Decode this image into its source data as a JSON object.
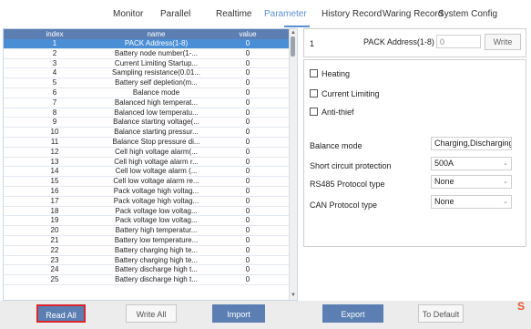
{
  "tabs": [
    {
      "label": "Monitor",
      "active": false
    },
    {
      "label": "Parallel",
      "active": false
    },
    {
      "label": "Realtime",
      "active": false
    },
    {
      "label": "Parameter",
      "active": true
    },
    {
      "label": "History Record",
      "active": false
    },
    {
      "label": "Waring Record",
      "active": false
    },
    {
      "label": "System Config",
      "active": false
    }
  ],
  "table": {
    "headers": [
      "index",
      "name",
      "value"
    ],
    "rows": [
      {
        "index": "1",
        "name": "PACK Address(1-8)",
        "value": "0"
      },
      {
        "index": "2",
        "name": "Battery node number(1-...",
        "value": "0"
      },
      {
        "index": "3",
        "name": "Current Limiting Startup...",
        "value": "0"
      },
      {
        "index": "4",
        "name": "Sampling resistance(0.01...",
        "value": "0"
      },
      {
        "index": "5",
        "name": "Battery self depletion(m...",
        "value": "0"
      },
      {
        "index": "6",
        "name": "Balance mode",
        "value": "0"
      },
      {
        "index": "7",
        "name": "Balanced high temperat...",
        "value": "0"
      },
      {
        "index": "8",
        "name": "Balanced low temperatu...",
        "value": "0"
      },
      {
        "index": "9",
        "name": "Balance starting voltage(...",
        "value": "0"
      },
      {
        "index": "10",
        "name": "Balance starting pressur...",
        "value": "0"
      },
      {
        "index": "11",
        "name": "Balance Stop pressure di...",
        "value": "0"
      },
      {
        "index": "12",
        "name": "Cell high voltage alarm(...",
        "value": "0"
      },
      {
        "index": "13",
        "name": "Cell high voltage alarm r...",
        "value": "0"
      },
      {
        "index": "14",
        "name": "Cell low voltage alarm (...",
        "value": "0"
      },
      {
        "index": "15",
        "name": "Cell low voltage alarm re...",
        "value": "0"
      },
      {
        "index": "16",
        "name": "Pack voltage high voltag...",
        "value": "0"
      },
      {
        "index": "17",
        "name": "Pack voltage high voltag...",
        "value": "0"
      },
      {
        "index": "18",
        "name": "Pack voltage low voltag...",
        "value": "0"
      },
      {
        "index": "19",
        "name": "Pack voltage low voltag...",
        "value": "0"
      },
      {
        "index": "20",
        "name": "Battery high temperatur...",
        "value": "0"
      },
      {
        "index": "21",
        "name": "Battery low temperature...",
        "value": "0"
      },
      {
        "index": "22",
        "name": "Battery charging high te...",
        "value": "0"
      },
      {
        "index": "23",
        "name": "Battery charging high te...",
        "value": "0"
      },
      {
        "index": "24",
        "name": "Battery discharge high t...",
        "value": "0"
      },
      {
        "index": "25",
        "name": "Battery discharge high t...",
        "value": "0"
      }
    ],
    "selected_row_index": 0
  },
  "pack_address": {
    "index_value": "1",
    "label": "PACK Address(1-8)",
    "input_value": "0",
    "write_label": "Write"
  },
  "checkboxes": [
    {
      "label": "Heating",
      "checked": false
    },
    {
      "label": "Current Limiting",
      "checked": false
    },
    {
      "label": "Anti-thief",
      "checked": false
    }
  ],
  "settings": [
    {
      "label": "Balance mode",
      "value": "Charging,Discharging"
    },
    {
      "label": "Short circuit protection",
      "value": "500A"
    },
    {
      "label": "RS485 Protocol type",
      "value": "None"
    },
    {
      "label": "CAN Protocol type",
      "value": "None"
    }
  ],
  "buttons": {
    "read_all": "Read All",
    "write_all": "Write All",
    "import": "Import",
    "export": "Export",
    "to_default": "To Default"
  },
  "colors": {
    "accent": "#5b7fb3",
    "selected_row": "#4a8ed6",
    "active_tab": "#5a8fd0",
    "highlight_border": "#d9262e"
  },
  "logo_text": "S"
}
